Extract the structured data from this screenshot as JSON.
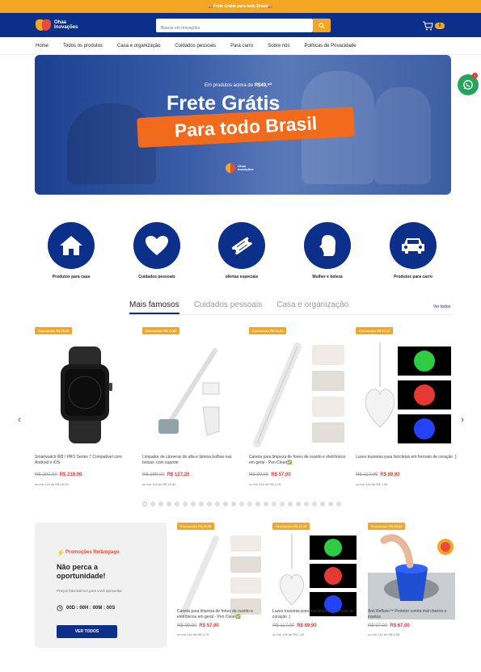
{
  "topbar": {
    "text": "🚚Frete Grátis para todo Brasil🚚"
  },
  "header": {
    "logo_text": "Ohaa Inovações",
    "search_placeholder": "Buscar em Inovações",
    "cart_count": "0",
    "colors": {
      "brand": "#0c2f8a",
      "accent": "#f5a623"
    }
  },
  "nav": [
    "Home",
    "Todos os produtos",
    "Casa e organização",
    "Cuidados pessoais",
    "Para carro",
    "Sobre nós",
    "Políticas de Privacidade"
  ],
  "hero": {
    "small_prefix": "Em produtos acima de ",
    "small_value": "R$49,⁹⁰",
    "title": "Frete Grátis",
    "pill": "Para todo Brasil",
    "logo_text": "Ohaa Inovações"
  },
  "whatsapp": {
    "icon": "whatsapp-icon",
    "badge": "1"
  },
  "categories": [
    {
      "label": "Produtos para casa",
      "icon": "house-icon"
    },
    {
      "label": "Cuidados pessoais",
      "icon": "heart-icon"
    },
    {
      "label": "ofertas especiais",
      "icon": "ticket-icon"
    },
    {
      "label": "Mulher e beleza",
      "icon": "woman-head-icon"
    },
    {
      "label": "Produtos para carro",
      "icon": "car-icon"
    }
  ],
  "tabs": [
    {
      "label": "Mais famosos",
      "active": true
    },
    {
      "label": "Cuidados pessoais",
      "active": false
    },
    {
      "label": "Casa e organização",
      "active": false
    }
  ],
  "see_all": "Ver todos",
  "products": [
    {
      "save": "Economize R$ 78,00",
      "name": "Smartwatch W8 / PRO Series 7 Compatível com Android e iOS",
      "old": "R$ 297,00",
      "new": "R$ 219,00",
      "installment": "ou em 12x de R$ 18,25"
    },
    {
      "save": "Economize R$ 71,80",
      "name": "Limpador de câmeras de alta e lâmina bolhas nas bolsas, com suporte",
      "old": "R$ 199,00",
      "new": "R$ 127,20",
      "installment": "ou em 12x de R$ 10,60"
    },
    {
      "save": "Economize R$ 42,90",
      "name": "Caneta para limpeza de fones de ouvido e eletrônicos em geral - Pen Clean✅",
      "old": "R$ 99,90",
      "new": "R$ 57,00",
      "installment": "ou em 12x de R$ 4,75"
    },
    {
      "save": "Economize R$ 27,10",
      "name": "Luzes traseiras para bicicletas em formato de coração :)",
      "old": "R$ 117,00",
      "new": "R$ 89,90",
      "installment": "ou em 12x de R$ 7,49"
    }
  ],
  "promo": {
    "eyebrow": "Promoções Relâmpago",
    "title": "Não perca a oportunidade!",
    "sub": "Preços baixíssimos para você aproveitar",
    "timer": "00D : 00H : 00M : 00S",
    "button": "VER TODOS"
  },
  "products2": [
    {
      "save": "Economize R$ 42,90",
      "name": "Caneta para limpeza de fones de ouvido e eletrônicos em geral - Pen Clean✅",
      "old": "R$ 99,90",
      "new": "R$ 57,00",
      "installment": "ou em 12x de R$ 4,75"
    },
    {
      "save": "Economize R$ 27,10",
      "name": "Luzes traseiras para bicicletas em formato de coração :)",
      "old": "R$ 117,00",
      "new": "R$ 89,90",
      "installment": "ou em 12x de R$ 7,49"
    },
    {
      "save": "Economize R$ 30,00",
      "name": "Anti Refluxo™ Protetor contra mal cheiros e insetos",
      "old": "R$ 97,00",
      "new": "R$ 67,00",
      "installment": "ou em 12x de R$ 5,58"
    }
  ]
}
